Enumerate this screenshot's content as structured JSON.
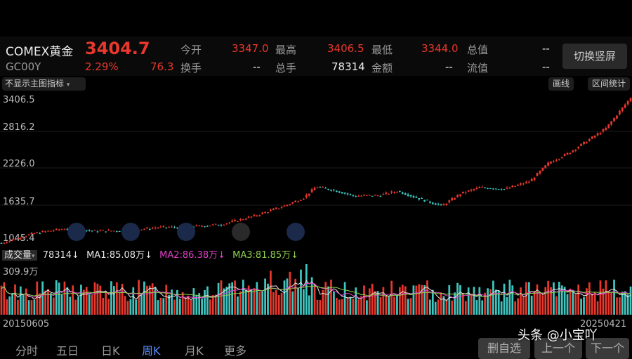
{
  "quote": {
    "name": "COMEX黄金",
    "code": "GC00Y",
    "price": "3404.7",
    "change_pct": "2.29%",
    "change_abs": "76.3"
  },
  "stats": {
    "open_label": "今开",
    "open": "3347.0",
    "high_label": "最高",
    "high": "3406.5",
    "low_label": "最低",
    "low": "3344.0",
    "total_value_label": "总值",
    "total_value": "--",
    "turnover_label": "换手",
    "turnover": "--",
    "volume_label": "总手",
    "volume": "78314",
    "amount_label": "金额",
    "amount": "--",
    "float_label": "流值",
    "float": "--"
  },
  "buttons": {
    "switch_portrait": "切换竖屏",
    "indicator": "不显示主图指标",
    "line": "画线",
    "range_stats": "区间统计"
  },
  "price_axis": [
    "3406.5",
    "2816.2",
    "2226.0",
    "1635.7",
    "1045.4"
  ],
  "volume_bar": {
    "label": "成交量",
    "value": "78314",
    "ma1": "MA1:85.08万",
    "ma2": "MA2:86.38万",
    "ma3": "MA3:81.85万",
    "max_label": "309.9万",
    "arrow": "↓"
  },
  "dates": {
    "start": "20150605",
    "end": "20250421"
  },
  "tabs": [
    "分时",
    "五日",
    "日K",
    "周K",
    "月K",
    "更多"
  ],
  "bottom_buttons": [
    "删自选",
    "上一个",
    "下一个"
  ],
  "watermark": "头条 @小宝吖",
  "colors": {
    "up": "#e8372c",
    "down": "#3fc6c0",
    "ma1": "#e6e6e6",
    "ma2": "#e040c8",
    "ma3": "#8fd14f",
    "accent_tab": "#5b8cff"
  },
  "chart_data": {
    "type": "line",
    "title": "",
    "x_range": [
      "20150605",
      "20250421"
    ],
    "ylim": [
      1045.4,
      3406.5
    ],
    "x": [
      0,
      0.05,
      0.1,
      0.15,
      0.2,
      0.25,
      0.3,
      0.35,
      0.4,
      0.45,
      0.48,
      0.5,
      0.53,
      0.56,
      0.6,
      0.63,
      0.66,
      0.7,
      0.73,
      0.76,
      0.8,
      0.84,
      0.87,
      0.9,
      0.93,
      0.96,
      1.0
    ],
    "values": [
      1045.4,
      1200,
      1280,
      1240,
      1250,
      1300,
      1310,
      1350,
      1480,
      1650,
      1780,
      1960,
      1900,
      1810,
      1820,
      1890,
      1780,
      1650,
      1850,
      1950,
      1920,
      2050,
      2350,
      2500,
      2700,
      2900,
      3406.5
    ]
  }
}
